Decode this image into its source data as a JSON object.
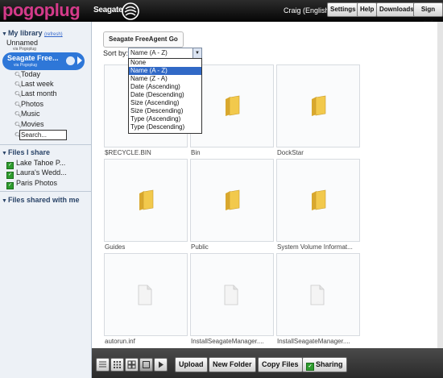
{
  "header": {
    "logo_text": "pogoplug",
    "brand": "Seagate",
    "user": "Craig (English)",
    "buttons": [
      "Settings",
      "Help",
      "Downloads",
      "Sign out"
    ]
  },
  "sidebar": {
    "library_title": "My library",
    "refresh_label": "(refresh)",
    "devices": [
      {
        "name": "Unnamed",
        "sub": "via Pogoplug"
      },
      {
        "name": "Seagate Free...",
        "sub": "via Pogoplug"
      }
    ],
    "nav": [
      "Today",
      "Last week",
      "Last month",
      "Photos",
      "Music",
      "Movies"
    ],
    "search_placeholder": "Search...",
    "files_i_share_title": "Files I share",
    "shares": [
      "Lake Tahoe P...",
      "Laura's Wedd...",
      "Paris Photos"
    ],
    "shared_with_me_title": "Files shared with me"
  },
  "main": {
    "device_tab": "Seagate FreeAgent Go",
    "sort_label": "Sort by:",
    "sort_selected": "Name (A - Z)",
    "sort_options": [
      "None",
      "Name (A - Z)",
      "Name (Z - A)",
      "Date (Ascending)",
      "Date (Descending)",
      "Size (Ascending)",
      "Size (Descending)",
      "Type (Ascending)",
      "Type (Descending)"
    ],
    "items": [
      {
        "name": "$RECYCLE.BIN",
        "icon": "folder-icon"
      },
      {
        "name": "Bin",
        "icon": "folder-icon"
      },
      {
        "name": "DockStar",
        "icon": "folder-icon"
      },
      {
        "name": "Guides",
        "icon": "folder-icon"
      },
      {
        "name": "Public",
        "icon": "folder-icon"
      },
      {
        "name": "System Volume Informat...",
        "icon": "folder-icon"
      },
      {
        "name": "autorun.inf",
        "icon": "document-icon"
      },
      {
        "name": "InstallSeagateManager....",
        "icon": "document-icon"
      },
      {
        "name": "InstallSeagateManager....",
        "icon": "document-icon"
      }
    ]
  },
  "toolbar": {
    "upload": "Upload",
    "new_folder": "New Folder",
    "copy_files": "Copy Files",
    "sharing": "Sharing"
  },
  "colors": {
    "logo_pink": "#d43a8a",
    "selection_blue": "#2e77d8",
    "dropdown_highlight": "#3169c6",
    "folder_yellow": "#f2c94c"
  }
}
